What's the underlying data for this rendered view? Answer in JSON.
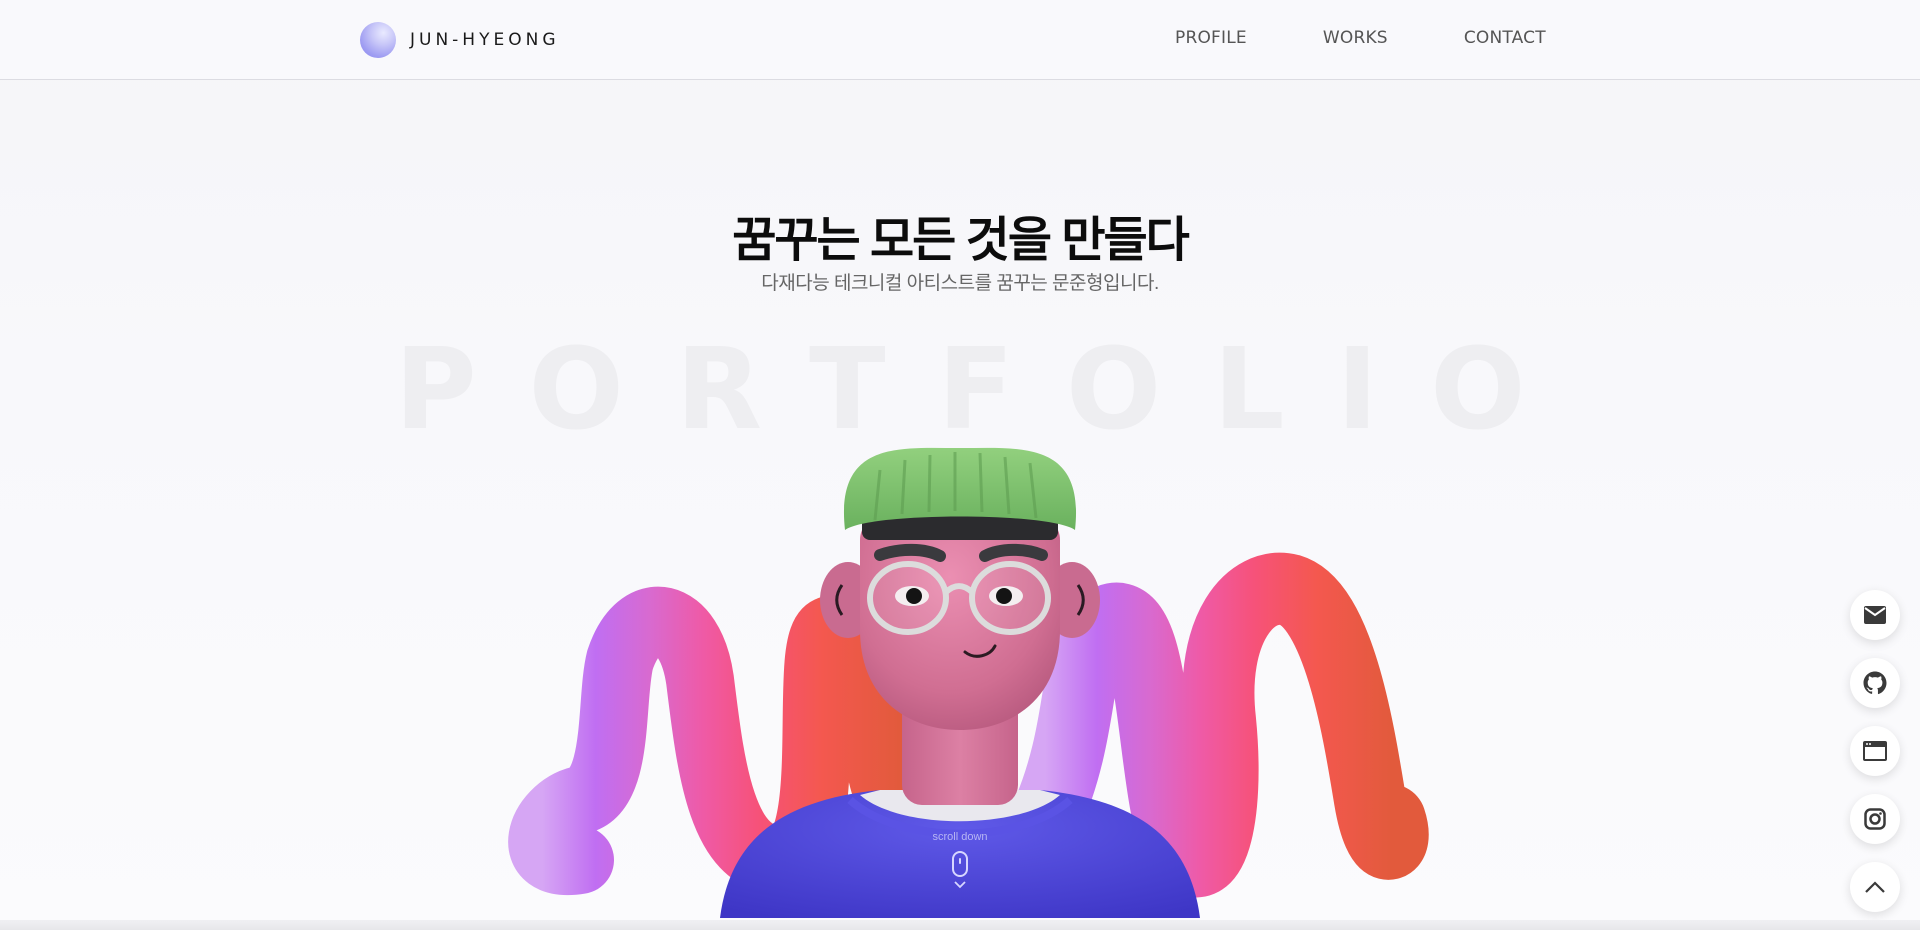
{
  "header": {
    "logo_text": "JUN-HYEONG",
    "nav": [
      {
        "label": "PROFILE"
      },
      {
        "label": "WORKS"
      },
      {
        "label": "CONTACT"
      }
    ]
  },
  "hero": {
    "title": "꿈꾸는 모든 것을 만들다",
    "subtitle": "다재다능 테크니컬 아티스트를 꿈꾸는 문준형입니다.",
    "background_word": "PORTFOLIO"
  },
  "scroll": {
    "label": "scroll down"
  },
  "quick_buttons": [
    {
      "icon": "mail-icon"
    },
    {
      "icon": "github-icon"
    },
    {
      "icon": "browser-window-icon"
    },
    {
      "icon": "instagram-icon"
    },
    {
      "icon": "chevron-up-icon"
    }
  ],
  "colors": {
    "accent": "#8a86ee",
    "shirt": "#4b45d6",
    "hat": "#7cbf6c",
    "skin": "#d9799a"
  }
}
